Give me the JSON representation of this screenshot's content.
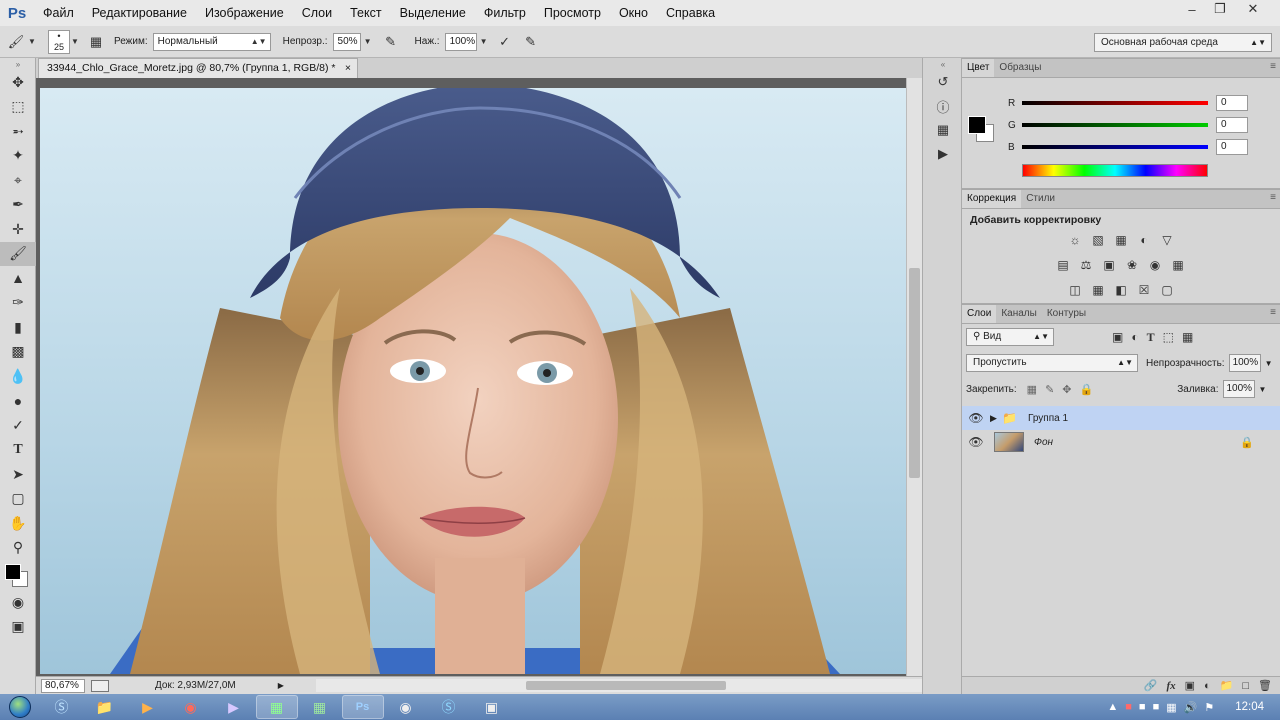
{
  "app": {
    "logo": "Ps"
  },
  "menu": [
    "Файл",
    "Редактирование",
    "Изображение",
    "Слои",
    "Текст",
    "Выделение",
    "Фильтр",
    "Просмотр",
    "Окно",
    "Справка"
  ],
  "options_bar": {
    "brush_size": "25",
    "mode_label": "Режим:",
    "mode_value": "Нормальный",
    "opacity_label": "Непрозр.:",
    "opacity_value": "50%",
    "flow_label": "Наж.:",
    "flow_value": "100%",
    "workspace": "Основная рабочая среда"
  },
  "document": {
    "tab_title": "33944_Chlo_Grace_Moretz.jpg @ 80,7% (Группа 1, RGB/8) *",
    "zoom": "80,67%",
    "doc_info": "Док: 2,93M/27,0M"
  },
  "color_panel": {
    "tabs": [
      "Цвет",
      "Образцы"
    ],
    "channels": [
      {
        "name": "R",
        "value": "0"
      },
      {
        "name": "G",
        "value": "0"
      },
      {
        "name": "B",
        "value": "0"
      }
    ]
  },
  "adjustments_panel": {
    "tabs": [
      "Коррекция",
      "Стили"
    ],
    "title": "Добавить корректировку"
  },
  "layers_panel": {
    "tabs": [
      "Слои",
      "Каналы",
      "Контуры"
    ],
    "filter": "Вид",
    "blend_mode": "Пропустить",
    "opacity_label": "Непрозрачность:",
    "opacity_value": "100%",
    "lock_label": "Закрепить:",
    "fill_label": "Заливка:",
    "fill_value": "100%",
    "layers": [
      {
        "name": "Группа 1",
        "type": "group",
        "selected": true
      },
      {
        "name": "Фон",
        "type": "background",
        "locked": true
      }
    ]
  },
  "taskbar": {
    "clock": "12:04"
  },
  "colors": {
    "accent_selected_layer": "#bfd3f3",
    "ps_blue": "#2c5fa6"
  }
}
